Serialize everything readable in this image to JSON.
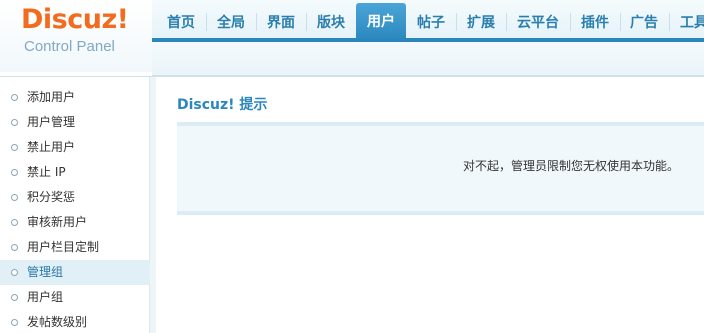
{
  "logo": {
    "main": "Discuz!",
    "sub": "Control Panel"
  },
  "nav": {
    "items": [
      "首页",
      "全局",
      "界面",
      "版块",
      "用户",
      "帖子",
      "扩展",
      "云平台",
      "插件",
      "广告",
      "工具"
    ],
    "active": "用户"
  },
  "sidebar": {
    "items": [
      "添加用户",
      "用户管理",
      "禁止用户",
      "禁止 IP",
      "积分奖惩",
      "审核新用户",
      "用户栏目定制",
      "管理组",
      "用户组",
      "发帖数级别"
    ],
    "active": "管理组"
  },
  "main": {
    "title": "Discuz! 提示",
    "message": "对不起，管理员限制您无权使用本功能。"
  },
  "colors": {
    "accent": "#2a87be",
    "logo": "#f26c1f",
    "active_item_bg": "#e1eff7"
  }
}
